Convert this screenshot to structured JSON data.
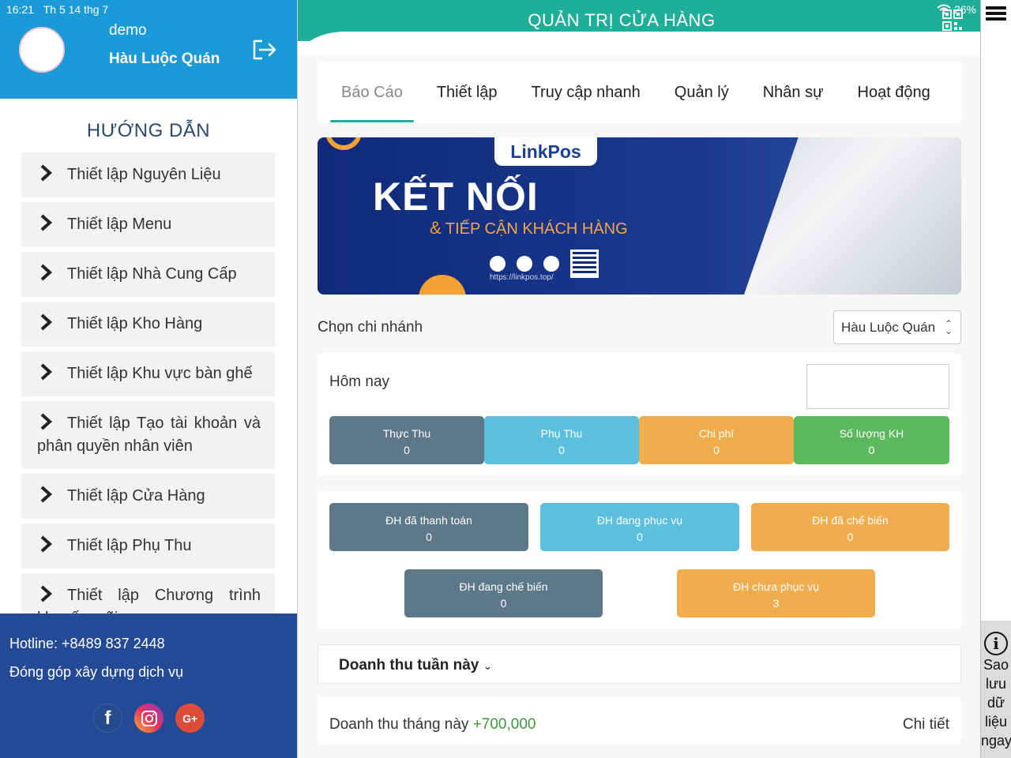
{
  "status_bar": {
    "time": "16:21",
    "date": "Th 5 14 thg 7",
    "battery": "26%"
  },
  "profile": {
    "name": "demo",
    "store": "Hàu Luộc Quán"
  },
  "guide": {
    "title": "HƯỚNG DẪN",
    "items": [
      "Thiết lập Nguyên Liệu",
      "Thiết lập Menu",
      "Thiết lập Nhà Cung Cấp",
      "Thiết lập Kho Hàng",
      "Thiết lập Khu vực bàn ghế",
      "Thiết lập Tạo tài khoản và phân quyền nhân viên",
      "Thiết lập Cửa Hàng",
      "Thiết lập Phụ Thu",
      "Thiết lập Chương trình khuyến mãi"
    ]
  },
  "footer": {
    "hotline": "Hotline: +8489 837 2448",
    "contribute": "Đóng góp xây dựng dịch vụ",
    "gplus_label": "G+"
  },
  "header": {
    "title": "QUẢN TRỊ CỬA HÀNG"
  },
  "tabs": [
    "Báo Cáo",
    "Thiết lập",
    "Truy cập nhanh",
    "Quản lý",
    "Nhân sự",
    "Hoạt động"
  ],
  "banner": {
    "logo": "LinkPos",
    "title": "KẾT NỐI",
    "subtitle_amp": "&",
    "subtitle": "TIẾP CẬN KHÁCH HÀNG",
    "url": "https://linkpos.top/"
  },
  "branch": {
    "label": "Chọn chi nhánh",
    "selected": "Hàu Luộc Quán"
  },
  "today": {
    "label": "Hôm nay",
    "stats": [
      {
        "label": "Thực Thu",
        "value": "0"
      },
      {
        "label": "Phụ Thu",
        "value": "0"
      },
      {
        "label": "Chi phí",
        "value": "0"
      },
      {
        "label": "Số lượng KH",
        "value": "0"
      }
    ]
  },
  "orders": [
    {
      "label": "ĐH đã thanh toán",
      "value": "0"
    },
    {
      "label": "ĐH đang phục vụ",
      "value": "0"
    },
    {
      "label": "ĐH đã chế biến",
      "value": "0"
    },
    {
      "label": "ĐH đang chế biến",
      "value": "0"
    },
    {
      "label": "ĐH chưa phục vụ",
      "value": "3"
    }
  ],
  "week": {
    "label": "Doanh thu tuần này"
  },
  "month": {
    "label": "Doanh thu tháng này",
    "value": "+700,000",
    "detail": "Chi tiết"
  },
  "save_panel": {
    "text": "Sao lưu dữ liệu ngay"
  },
  "colors": {
    "header": "#1fae98",
    "profile": "#1b9ad8",
    "footer": "#254a95",
    "stat_gray": "#5d7888",
    "stat_blue": "#5bc0de",
    "stat_orange": "#f0ad4e",
    "stat_green": "#5cb85c"
  }
}
